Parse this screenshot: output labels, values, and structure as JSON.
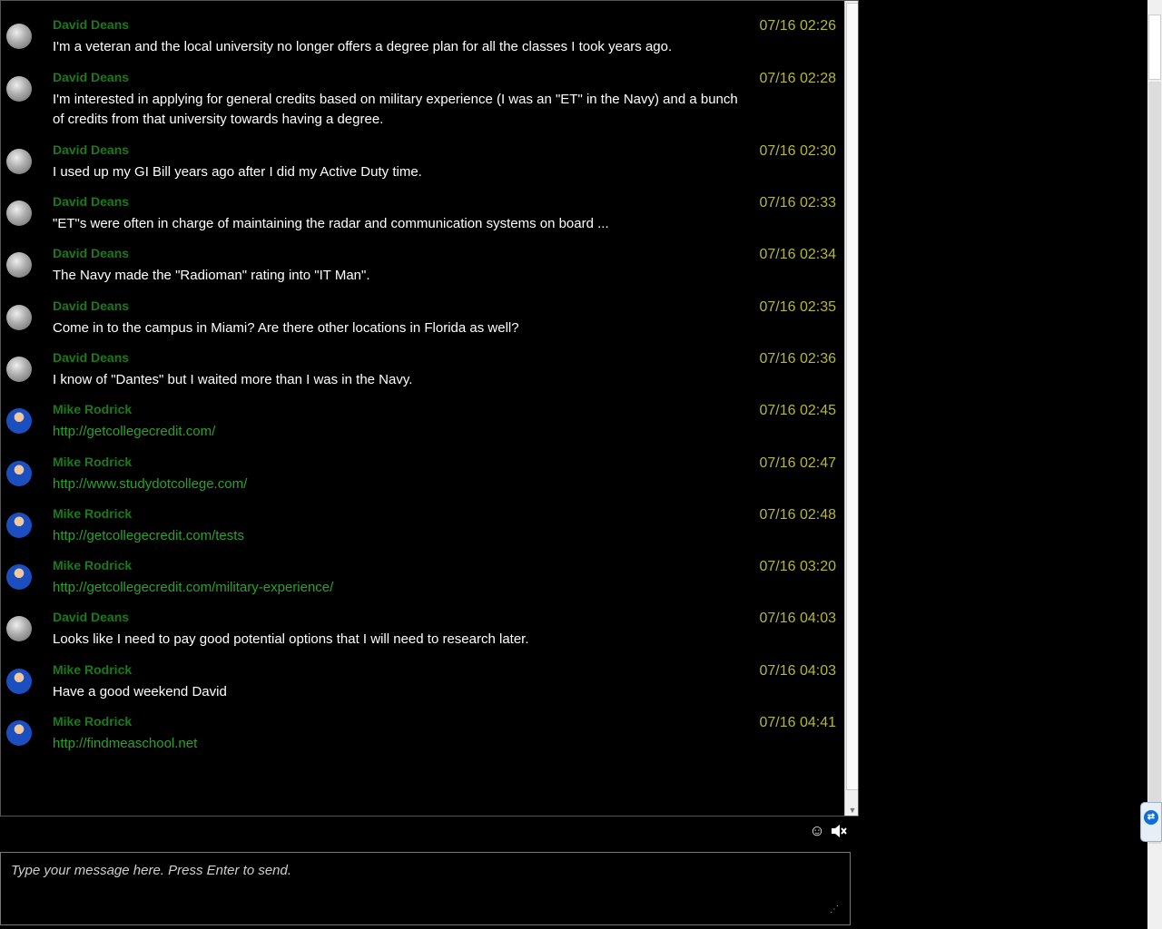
{
  "messages": [
    {
      "author": "David Deans",
      "time": "07/16 02:26",
      "text": "I'm a veteran and the local university no longer offers a degree plan for all the classes I took years ago.",
      "avatar": "gray",
      "link": false
    },
    {
      "author": "David Deans",
      "time": "07/16 02:28",
      "text": "I'm interested in applying for general credits based on military experience (I was an \"ET\" in the Navy) and a bunch of credits from that university towards having a degree.",
      "avatar": "gray",
      "link": false
    },
    {
      "author": "David Deans",
      "time": "07/16 02:30",
      "text": "I used up my GI Bill years ago after I did my Active Duty time.",
      "avatar": "gray",
      "link": false
    },
    {
      "author": "David Deans",
      "time": "07/16 02:33",
      "text": "\"ET\"s were often in charge of maintaining the radar and communication systems on board ...",
      "avatar": "gray",
      "link": false
    },
    {
      "author": "David Deans",
      "time": "07/16 02:34",
      "text": "The Navy made the \"Radioman\" rating into \"IT Man\".",
      "avatar": "gray",
      "link": false
    },
    {
      "author": "David Deans",
      "time": "07/16 02:35",
      "text": "Come in to the campus in Miami? Are there other locations in Florida as well?",
      "avatar": "gray",
      "link": false
    },
    {
      "author": "David Deans",
      "time": "07/16 02:36",
      "text": "I know of \"Dantes\" but I waited more than I was in the Navy.",
      "avatar": "gray",
      "link": false
    },
    {
      "author": "Mike Rodrick",
      "time": "07/16 02:45",
      "text": "http://getcollegecredit.com/",
      "avatar": "blue",
      "link": true
    },
    {
      "author": "Mike Rodrick",
      "time": "07/16 02:47",
      "text": "http://www.studydotcollege.com/",
      "avatar": "blue",
      "link": true
    },
    {
      "author": "Mike Rodrick",
      "time": "07/16 02:48",
      "text": "http://getcollegecredit.com/tests",
      "avatar": "blue",
      "link": true
    },
    {
      "author": "Mike Rodrick",
      "time": "07/16 03:20",
      "text": "http://getcollegecredit.com/military-experience/",
      "avatar": "blue",
      "link": true
    },
    {
      "author": "David Deans",
      "time": "07/16 04:03",
      "text": "Looks like I need to pay good potential options that I will need to research later.",
      "avatar": "gray",
      "link": false
    },
    {
      "author": "Mike Rodrick",
      "time": "07/16 04:03",
      "text": "Have a good weekend David",
      "avatar": "blue",
      "link": false
    },
    {
      "author": "Mike Rodrick",
      "time": "07/16 04:41",
      "text": "http://findmeaschool.net",
      "avatar": "blue",
      "link": true
    }
  ],
  "toolbar": {
    "emoji_icon": "smiley-icon",
    "sound_icon": "speaker-muted-icon"
  },
  "input": {
    "placeholder": "Type your message here. Press Enter to send."
  },
  "colors": {
    "background": "#000000",
    "author": "#1a7a1a",
    "timestamp": "#b6b63a",
    "message_text": "#ffffff",
    "link_text": "#2aa12a"
  }
}
